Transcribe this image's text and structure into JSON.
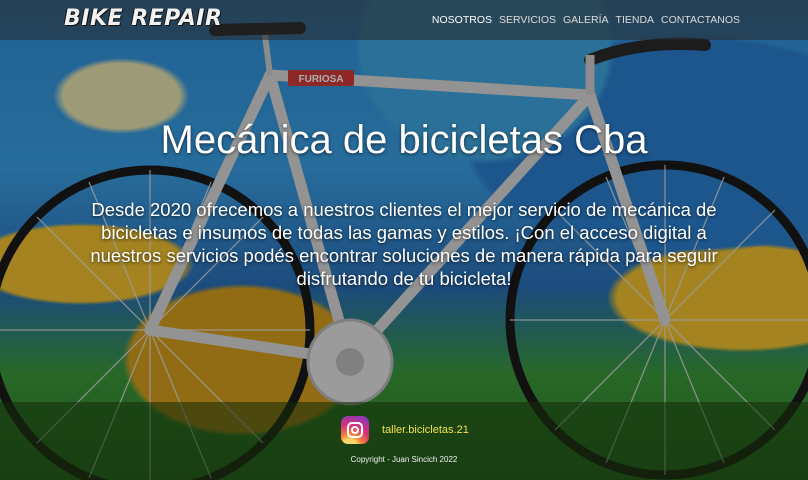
{
  "navbar": {
    "brand": "BIKE REPAIR",
    "links": [
      {
        "label": "NOSOTROS",
        "active": true
      },
      {
        "label": "SERVICIOS",
        "active": false
      },
      {
        "label": "GALERÍA",
        "active": false
      },
      {
        "label": "TIENDA",
        "active": false
      },
      {
        "label": "CONTACTANOS",
        "active": false
      }
    ]
  },
  "hero": {
    "title": "Mecánica de bicicletas Cba",
    "description": "Desde 2020 ofrecemos a nuestros clientes el mejor servicio de mecánica de bicicletas e insumos de todas las gamas y estilos. ¡Con el acceso digital a nuestros servicios podés encontrar soluciones de manera rápida para seguir disfrutando de tu bicicleta!",
    "frame_label": "FURIOSA"
  },
  "footer": {
    "instagram_icon": "instagram-icon",
    "instagram_handle": "taller.bicicletas.21",
    "copyright": "Copyright - Juan Sincich 2022"
  },
  "colors": {
    "handle": "#f2e24a",
    "navbar_bg": "rgba(40,40,40,0.55)",
    "text": "#ffffff"
  }
}
